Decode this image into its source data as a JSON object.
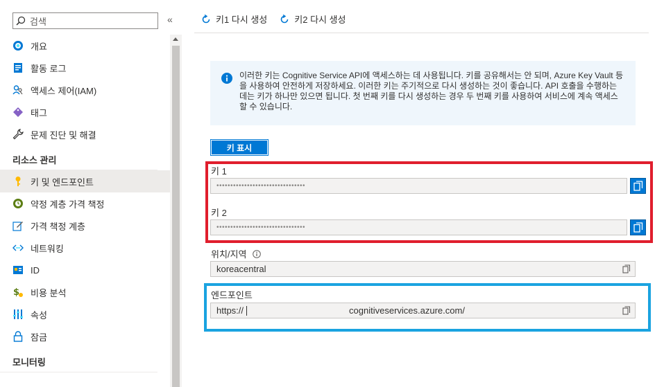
{
  "sidebar": {
    "search_placeholder": "검색",
    "collapse_glyph": "«",
    "items": [
      {
        "label": "개요",
        "icon": "overview-icon"
      },
      {
        "label": "활동 로그",
        "icon": "activity-log-icon"
      },
      {
        "label": "액세스 제어(IAM)",
        "icon": "iam-icon"
      },
      {
        "label": "태그",
        "icon": "tag-icon"
      },
      {
        "label": "문제 진단 및 해결",
        "icon": "wrench-icon"
      }
    ],
    "section_resource": "리소스 관리",
    "resource_items": [
      {
        "label": "키 및 엔드포인트",
        "icon": "key-icon",
        "active": true
      },
      {
        "label": "약정 계층 가격 책정",
        "icon": "pricing-icon"
      },
      {
        "label": "가격 책정 계층",
        "icon": "edit-icon"
      },
      {
        "label": "네트워킹",
        "icon": "networking-icon"
      },
      {
        "label": "ID",
        "icon": "id-icon"
      },
      {
        "label": "비용 분석",
        "icon": "cost-icon"
      },
      {
        "label": "속성",
        "icon": "properties-icon"
      },
      {
        "label": "잠금",
        "icon": "lock-icon"
      }
    ],
    "section_monitoring": "모니터링"
  },
  "toolbar": {
    "regen_key1": "키1 다시 생성",
    "regen_key2": "키2 다시 생성"
  },
  "info": {
    "text": "이러한 키는 Cognitive Service API에 액세스하는 데 사용됩니다. 키를 공유해서는 안 되며, Azure Key Vault 등을 사용하여 안전하게 저장하세요. 이러한 키는 주기적으로 다시 생성하는 것이 좋습니다. API 호출을 수행하는 데는 키가 하나만 있으면 됩니다. 첫 번째 키를 다시 생성하는 경우 두 번째 키를 사용하여 서비스에 계속 액세스할 수 있습니다."
  },
  "show_keys_label": "키 표시",
  "key1": {
    "label": "키 1",
    "value": "••••••••••••••••••••••••••••••••"
  },
  "key2": {
    "label": "키 2",
    "value": "••••••••••••••••••••••••••••••••"
  },
  "location": {
    "label": "위치/지역",
    "value": "koreacentral"
  },
  "endpoint": {
    "label": "엔드포인트",
    "value_prefix": "https://",
    "value_suffix": "cognitiveservices.azure.com/"
  },
  "colors": {
    "accent": "#0078d4",
    "red_highlight": "#e01e2d",
    "blue_highlight": "#1aa3e0"
  }
}
